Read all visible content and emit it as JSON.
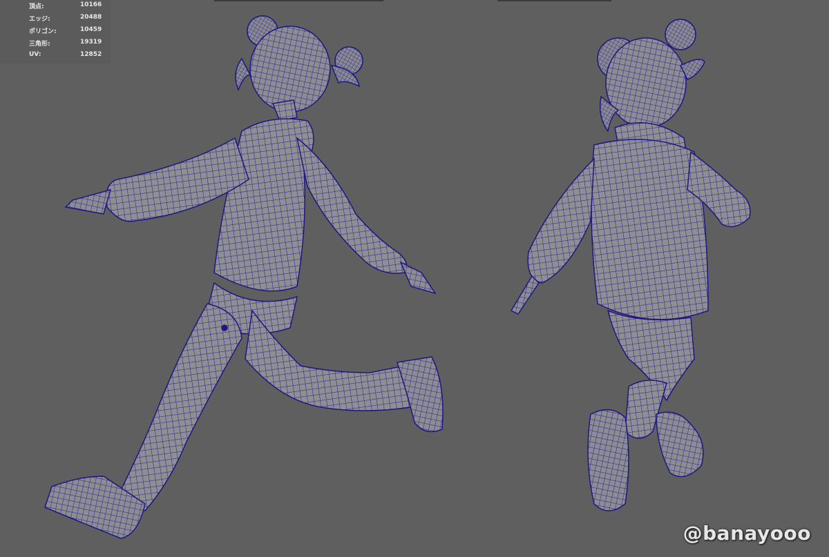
{
  "hud": {
    "rows": [
      {
        "label": "頂点:",
        "value": "10166"
      },
      {
        "label": "エッジ:",
        "value": "20488"
      },
      {
        "label": "ポリゴン:",
        "value": "10459"
      },
      {
        "label": "三角形:",
        "value": "19319"
      },
      {
        "label": "UV:",
        "value": "12852"
      }
    ]
  },
  "watermark": "@banayooo",
  "colors": {
    "background": "#5f5f5f",
    "mesh_fill": "#8f8f94",
    "wire": "#1f1b8a",
    "hud_text": "#e8e8e8"
  }
}
